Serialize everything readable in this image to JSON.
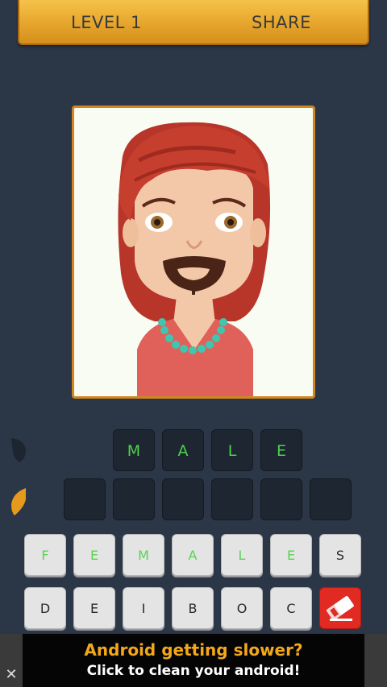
{
  "header": {
    "level_label": "LEVEL 1",
    "share_label": "SHARE"
  },
  "picture": {
    "icon": "bearded-woman-avatar"
  },
  "answer": {
    "letters": [
      "M",
      "A",
      "L",
      "E"
    ]
  },
  "guess": {
    "slots": [
      "",
      "",
      "",
      "",
      "",
      ""
    ]
  },
  "keyboard": {
    "row1": [
      "F",
      "E",
      "M",
      "A",
      "L",
      "E",
      "S"
    ],
    "row2": [
      "D",
      "E",
      "I",
      "B",
      "O",
      "C"
    ]
  },
  "ad": {
    "headline": "Android getting slower?",
    "subline": "Click to clean your android!",
    "close_glyph": "✕"
  },
  "colors": {
    "background": "#2b3746",
    "accent": "#f3a81c",
    "answer_letter": "#4dd24a"
  }
}
